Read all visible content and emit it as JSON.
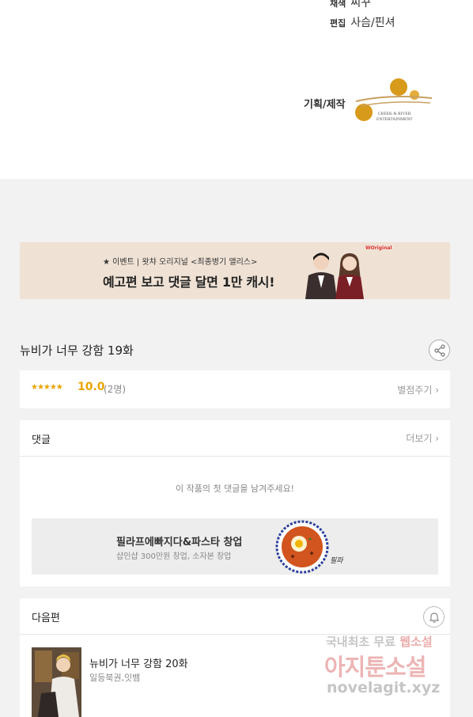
{
  "credits": {
    "art_key": "채색",
    "art_value": "씨꾸",
    "edit_key": "편집",
    "edit_value": "사슴/핀셔",
    "plan_key": "기획/제작",
    "logo_line1": "CREEK & RIVER",
    "logo_line2": "ENTERTAINMENT"
  },
  "banner": {
    "sub": "★ 이벤트 | 왓챠 오리지널 <최종병기 앨리스>",
    "main": "예고편 보고 댓글 달면 1만 캐시!",
    "tag": "WOriginal"
  },
  "episode": {
    "title": "뉴비가 너무 강함 19화"
  },
  "rating": {
    "stars": "★★★★★",
    "score": "10.0",
    "count": "(2명)",
    "rate_link": "별점주기 ›"
  },
  "comments": {
    "heading": "댓글",
    "more_link": "더보기 ›",
    "empty_message": "이 작품의 첫 댓글을 남겨주세요!"
  },
  "ad": {
    "title": "필라프에빠지다&파스타 창업",
    "subtitle": "샵인샵 300만원 창업, 소자본 창업",
    "signature": "필파"
  },
  "next_episode": {
    "heading": "다음편",
    "title": "뉴비가 너무 강함 20화",
    "author": "일등북권,잇뱀"
  },
  "watermark": {
    "line1_a": "국내최초 무료",
    "line1_b": "웹소설",
    "line2": "아지툰소설",
    "line3": "novelagit.xyz"
  },
  "colors": {
    "rating_accent": "#e9a400",
    "banner_bg": "#efe2d5",
    "logo_gold": "#d89a1a"
  }
}
